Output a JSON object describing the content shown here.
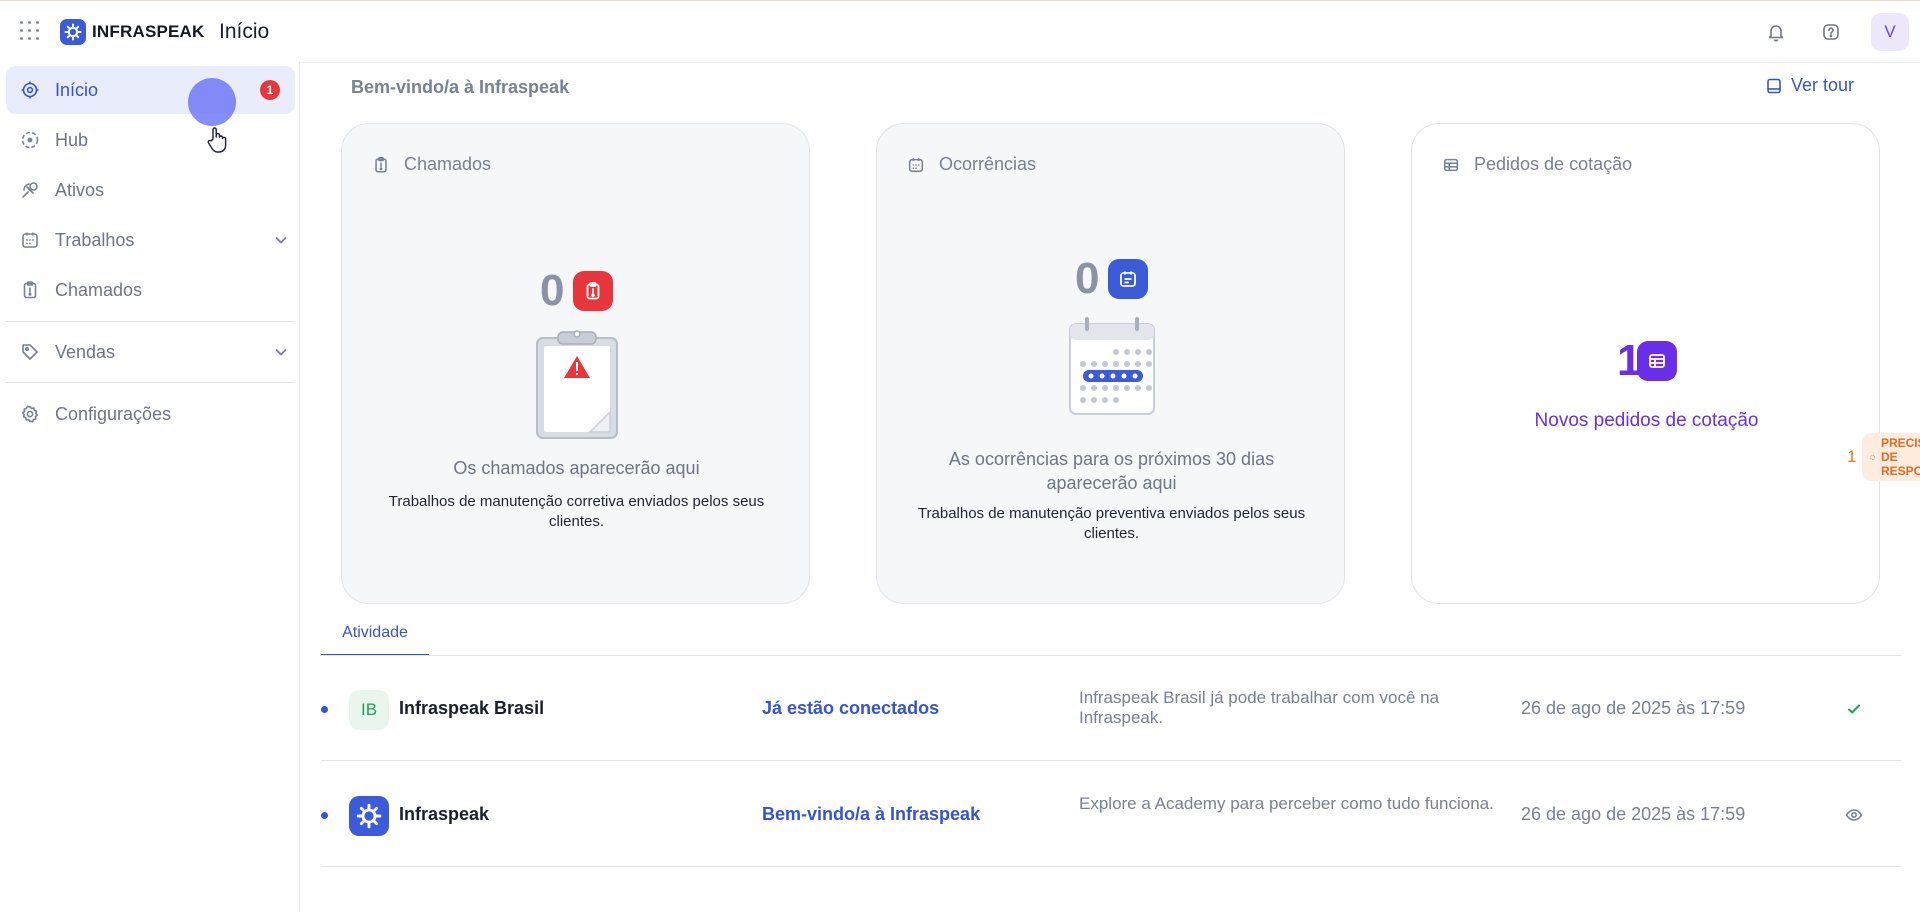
{
  "header": {
    "brand": "INFRASPEAK",
    "page_title": "Início",
    "avatar_initial": "V",
    "icons": {
      "apps": "grid-icon",
      "notifications": "bell-icon",
      "help": "help-icon"
    }
  },
  "sidebar": {
    "items": [
      {
        "label": "Início",
        "icon": "home-target-icon",
        "badge": "1",
        "active": true
      },
      {
        "label": "Hub",
        "icon": "hub-icon"
      },
      {
        "label": "Ativos",
        "icon": "assets-icon"
      },
      {
        "label": "Trabalhos",
        "icon": "calendar-icon",
        "expandable": true
      },
      {
        "label": "Chamados",
        "icon": "clipboard-icon"
      },
      {
        "label": "Vendas",
        "icon": "tag-icon",
        "expandable": true
      },
      {
        "label": "Configurações",
        "icon": "gear-icon"
      }
    ]
  },
  "main": {
    "welcome": "Bem-vindo/a à Infraspeak",
    "tour_label": "Ver tour",
    "cards": [
      {
        "title": "Chamados",
        "count": "0",
        "empty_title": "Os chamados aparecerão aqui",
        "empty_desc": "Trabalhos de manutenção corretiva enviados pelos seus clientes."
      },
      {
        "title": "Ocorrências",
        "count": "0",
        "empty_title": "As ocorrências para os próximos 30 dias aparecerão aqui",
        "empty_desc": "Trabalhos de manutenção preventiva enviados pelos seus clientes."
      },
      {
        "title": "Pedidos de cotação",
        "count": "1",
        "subtitle": "Novos pedidos de cotação",
        "status_count": "1",
        "status_label": "PRECISA DE RESPOSTA"
      }
    ],
    "tabs": [
      {
        "label": "Atividade"
      }
    ],
    "activity": [
      {
        "avatar_text": "IB",
        "name": "Infraspeak Brasil",
        "link": "Já estão conectados",
        "desc": "Infraspeak Brasil já pode trabalhar com você na Infraspeak.",
        "date": "26 de ago de 2025 às 17:59",
        "action_icon": "check-icon"
      },
      {
        "avatar_text": "",
        "name": "Infraspeak",
        "link": "Bem-vindo/a à Infraspeak",
        "desc": "Explore a Academy para perceber como tudo funciona.",
        "date": "26 de ago de 2025 às 17:59",
        "action_icon": "eye-icon"
      }
    ]
  },
  "colors": {
    "accent": "#3554d1",
    "badge_red": "#e8363d",
    "calendar_blue": "#3b5bdb",
    "quote_purple": "#6b2ee8",
    "warning_orange": "#e26b1f",
    "success_green": "#22a05b"
  }
}
